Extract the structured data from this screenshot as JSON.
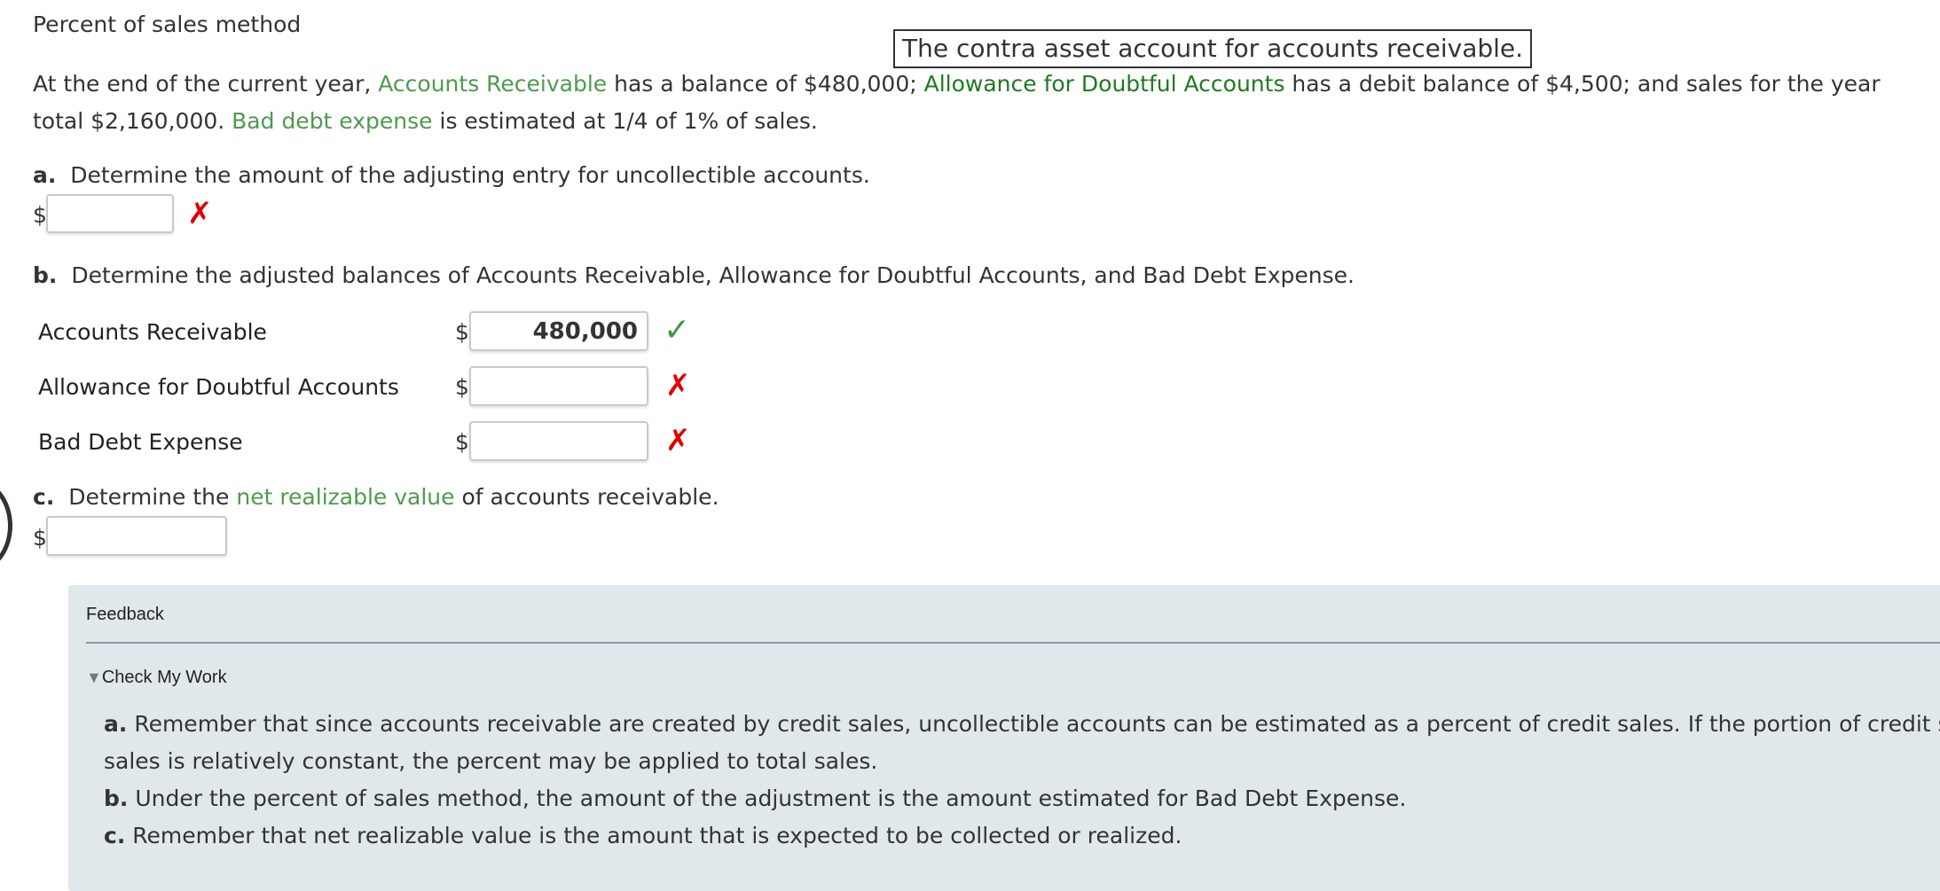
{
  "title": "Percent of sales method",
  "tooltip": "The contra asset account for accounts receivable.",
  "intro": {
    "t1": "At the end of the current year, ",
    "ar_link": "Accounts Receivable",
    "t2": " has a balance of $480,000; ",
    "afda_link": "Allowance for Doubtful Accounts",
    "t3": " has a debit balance of $4,500; and sales for the year total $2,160,000. ",
    "bde_link": "Bad debt expense",
    "t4": " is estimated at 1/4 of 1% of sales."
  },
  "colors": {
    "link_light": "#4d9b4d",
    "link_dark": "#1e7b1e",
    "error": "#e00000",
    "correct": "#3a9a3a",
    "feedback_bg": "#e1e8eb"
  },
  "part_a": {
    "letter": "a.",
    "question": "Determine the amount of the adjusting entry for uncollectible accounts.",
    "currency": "$",
    "value": "",
    "status_icon": "x-icon"
  },
  "part_b": {
    "letter": "b.",
    "question": "Determine the adjusted balances of Accounts Receivable, Allowance for Doubtful Accounts, and Bad Debt Expense.",
    "rows": [
      {
        "label": "Accounts Receivable",
        "currency": "$",
        "value": "480,000",
        "status_icon": "check-icon"
      },
      {
        "label": "Allowance for Doubtful Accounts",
        "currency": "$",
        "value": "",
        "status_icon": "x-icon"
      },
      {
        "label": "Bad Debt Expense",
        "currency": "$",
        "value": "",
        "status_icon": "x-icon"
      }
    ]
  },
  "part_c": {
    "letter": "c.",
    "t1": "Determine the ",
    "nrv_link": "net realizable value",
    "t2": " of accounts receivable.",
    "currency": "$",
    "value": ""
  },
  "feedback": {
    "title": "Feedback",
    "toggle_label": "Check My Work",
    "toggle_icon": "triangle-down-icon",
    "items": [
      {
        "letter": "a.",
        "text": "Remember that since accounts receivable are created by credit sales, uncollectible accounts can be estimated as a percent of credit sales. If the portion of credit sales to",
        "text2": "sales is relatively constant, the percent may be applied to total sales."
      },
      {
        "letter": "b.",
        "text": "Under the percent of sales method, the amount of the adjustment is the amount estimated for Bad Debt Expense."
      },
      {
        "letter": "c.",
        "text": "Remember that net realizable value is the amount that is expected to be collected or realized."
      }
    ]
  }
}
